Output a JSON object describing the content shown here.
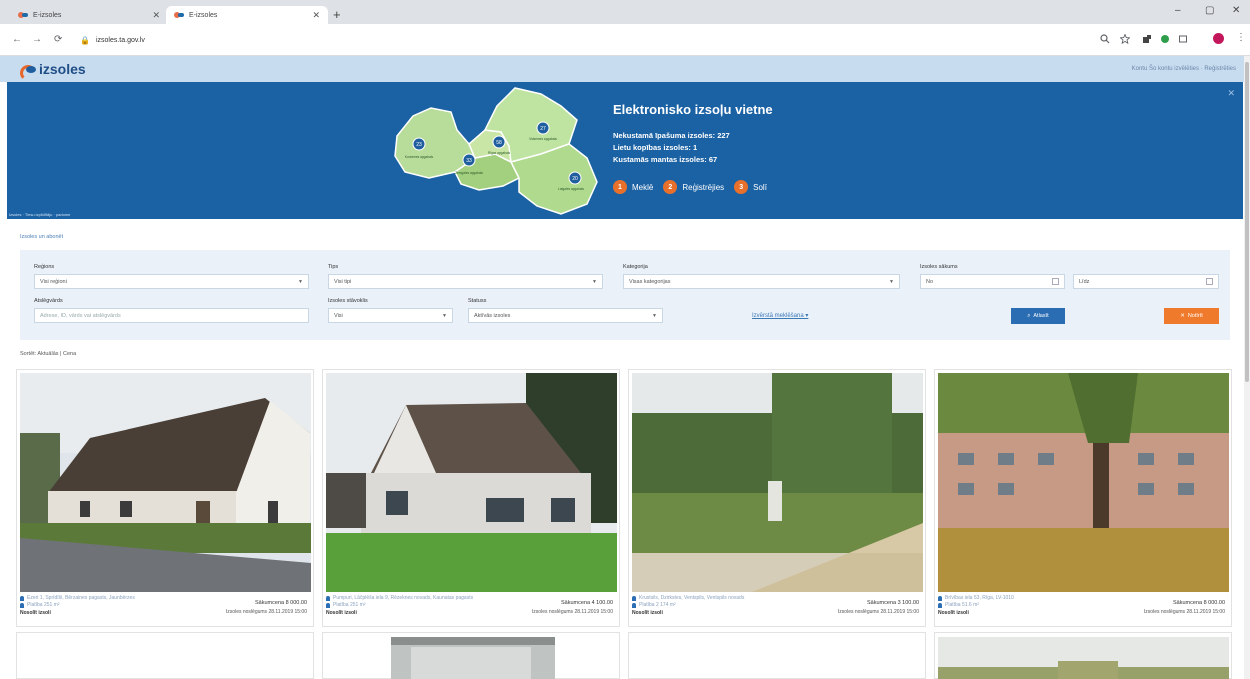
{
  "browser": {
    "tabs": [
      {
        "label": "E-izsoles",
        "active": false
      },
      {
        "label": "E-izsoles",
        "active": true
      }
    ],
    "new_tab": "+",
    "url": "izsoles.ta.gov.lv",
    "window_controls": {
      "minimize": "–",
      "maximize": "▢",
      "close": "✕"
    },
    "nav": {
      "back": "←",
      "forward": "→",
      "reload": "⟳"
    },
    "profile_color": "#c2185b"
  },
  "site": {
    "logo_text": "izsoles",
    "header_right": "Kontu Šo kontu izvēlēties · Reģistrēties"
  },
  "hero": {
    "title": "Elektronisko izsoļu vietne",
    "stats": [
      "Nekustamā īpašuma izsoles: 227",
      "Lietu kopības izsoles: 1",
      "Kustamās mantas izsoles: 67"
    ],
    "steps": [
      {
        "num": "1",
        "label": "Meklē"
      },
      {
        "num": "2",
        "label": "Reģistrējies"
      },
      {
        "num": "3",
        "label": "Solī"
      }
    ],
    "close": "✕",
    "footnote": "Izsoles · Tiesu izpildītāju · padome",
    "regions": [
      {
        "count": "23",
        "label": "Kurzemes apgabals"
      },
      {
        "count": "33",
        "label": "Zemgales apgabals"
      },
      {
        "count": "58",
        "label": "Rīgas apgabals"
      },
      {
        "count": "27",
        "label": "Vidzemes apgabals"
      },
      {
        "count": "20",
        "label": "Latgales apgabals"
      }
    ],
    "accent": "#1b62a4",
    "step_color": "#e8702a"
  },
  "subscribe_link": "Izsoles un abonēt",
  "filters": {
    "region": {
      "label": "Reģions",
      "value": "Visi reģioni"
    },
    "type": {
      "label": "Tips",
      "value": "Visi tipi"
    },
    "category": {
      "label": "Kategorija",
      "value": "Visas kategorijas"
    },
    "date": {
      "label": "Izsoles sākums",
      "from": "No",
      "to": "Līdz"
    },
    "keyword": {
      "label": "Atslēgvārds",
      "placeholder": "Adrese, ID, vārds vai atslēgvārds"
    },
    "stage": {
      "label": "Izsoles stāvoklis",
      "value": "Visi"
    },
    "status": {
      "label": "Statuss",
      "value": "Aktīvās izsoles"
    },
    "extended": "Izvērstā meklēšana ▾",
    "search_btn": "Atlasīt",
    "reset_btn": "Notīrīt"
  },
  "sortbar": "Sortēt: Aktuālās | Cena",
  "listings": [
    {
      "address": "Ezeri 1, Sprīdīši, Bērzaines pagasts, Jaunbērzes",
      "distance": "Platība 251 m²",
      "status": "Nosolīt izsoli",
      "price": "Sākumcena 8 000.00",
      "deadline": "Izsoles noslēgums 28.11.2019 15:00"
    },
    {
      "address": "Pumpuri, Lāčplēša iela 9, Rēzeknes novads, Kaunatas pagasts",
      "distance": "Platība 251 m²",
      "status": "Nosolīt izsoli",
      "price": "Sākumcena 4 100.00",
      "deadline": "Izsoles noslēgums 28.11.2019 15:00"
    },
    {
      "address": "Krustsils, Dzirkstes, Ventspils, Ventspils novads",
      "distance": "Platība 2 174 m²",
      "status": "Nosolīt izsoli",
      "price": "Sākumcena 3 100.00",
      "deadline": "Izsoles noslēgums 28.11.2019 15:00"
    },
    {
      "address": "Brīvības iela 53, Rīga, LV-1010",
      "distance": "Platība 51.6 m²",
      "status": "Nosolīt izsoli",
      "price": "Sākumcena 8 000.00",
      "deadline": "Izsoles noslēgums 28.11.2019 15:00"
    }
  ]
}
